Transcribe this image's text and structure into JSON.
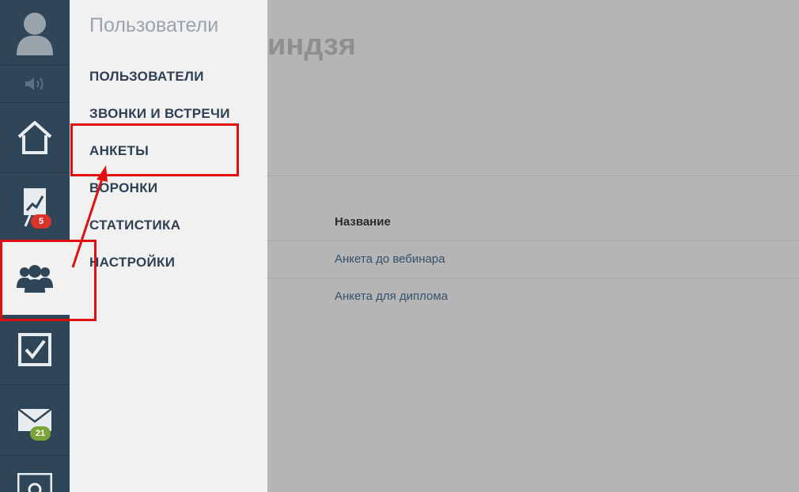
{
  "rail": {
    "items": [
      {
        "name": "avatar",
        "icon": "user-silhouette-icon"
      },
      {
        "name": "sound",
        "icon": "speaker-icon"
      },
      {
        "name": "home",
        "icon": "home-icon"
      },
      {
        "name": "stats",
        "icon": "chart-board-icon",
        "badge": "5"
      },
      {
        "name": "users",
        "icon": "users-group-icon",
        "active": true
      },
      {
        "name": "tasks",
        "icon": "checkbox-icon"
      },
      {
        "name": "mail",
        "icon": "envelope-icon",
        "badge": "21"
      },
      {
        "name": "settings",
        "icon": "gear-icon"
      }
    ],
    "badge_stats": "5",
    "badge_mail": "21",
    "colors": {
      "rail_bg": "#2f4558",
      "badge_red": "#d9342b",
      "badge_green": "#7ba33a"
    }
  },
  "submenu": {
    "title": "Пользователи",
    "items": [
      {
        "label": "ПОЛЬЗОВАТЕЛИ"
      },
      {
        "label": "ЗВОНКИ И ВСТРЕЧИ"
      },
      {
        "label": "АНКЕТЫ"
      },
      {
        "label": "ВОРОНКИ"
      },
      {
        "label": "СТАТИСТИКА"
      },
      {
        "label": "НАСТРОЙКИ"
      }
    ]
  },
  "main": {
    "title_fragment": "индзя",
    "table": {
      "header": "Название",
      "rows": [
        "Анкета до вебинара",
        "Анкета для диплома"
      ]
    }
  },
  "annotation_color": "#e01010"
}
